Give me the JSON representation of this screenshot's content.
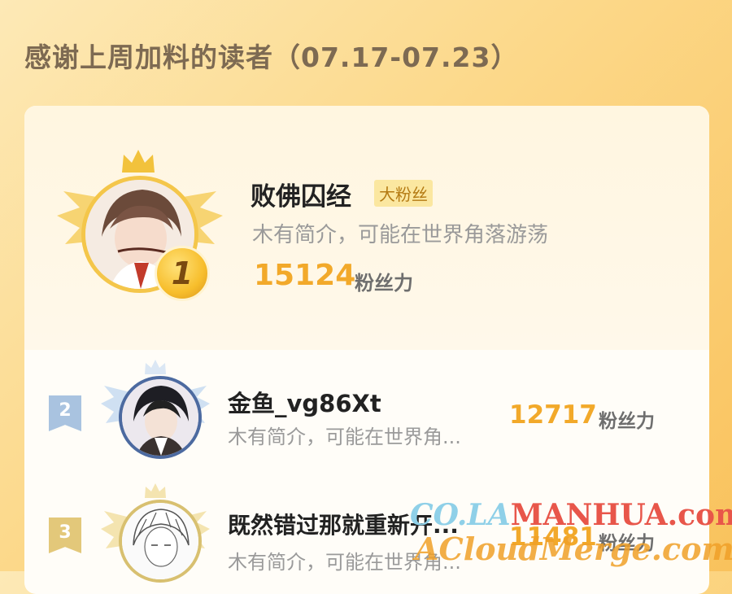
{
  "heading": "感谢上周加料的读者（07.17-07.23）",
  "entries": [
    {
      "rank": "1",
      "name": "败佛囚经",
      "tag": "大粉丝",
      "bio": "木有简介，可能在世界角落游荡",
      "score": "15124",
      "unit": "粉丝力"
    },
    {
      "rank": "2",
      "name": "金鱼_vg86Xt",
      "bio": "木有简介，可能在世界角...",
      "score": "12717",
      "unit": "粉丝力"
    },
    {
      "rank": "3",
      "name": "既然错过那就重新开...",
      "bio": "木有简介，可能在世界角...",
      "score": "11481",
      "unit": "粉丝力"
    }
  ],
  "watermark": {
    "line1_prefix": "CO.LA",
    "line1_main": "MANHUA.com",
    "line2": "ACloudMerge.com"
  },
  "colors": {
    "accent": "#f2a92a",
    "gold": "#f2c23c",
    "silver": "#a9c3e0",
    "bronze": "#e3c87a"
  }
}
